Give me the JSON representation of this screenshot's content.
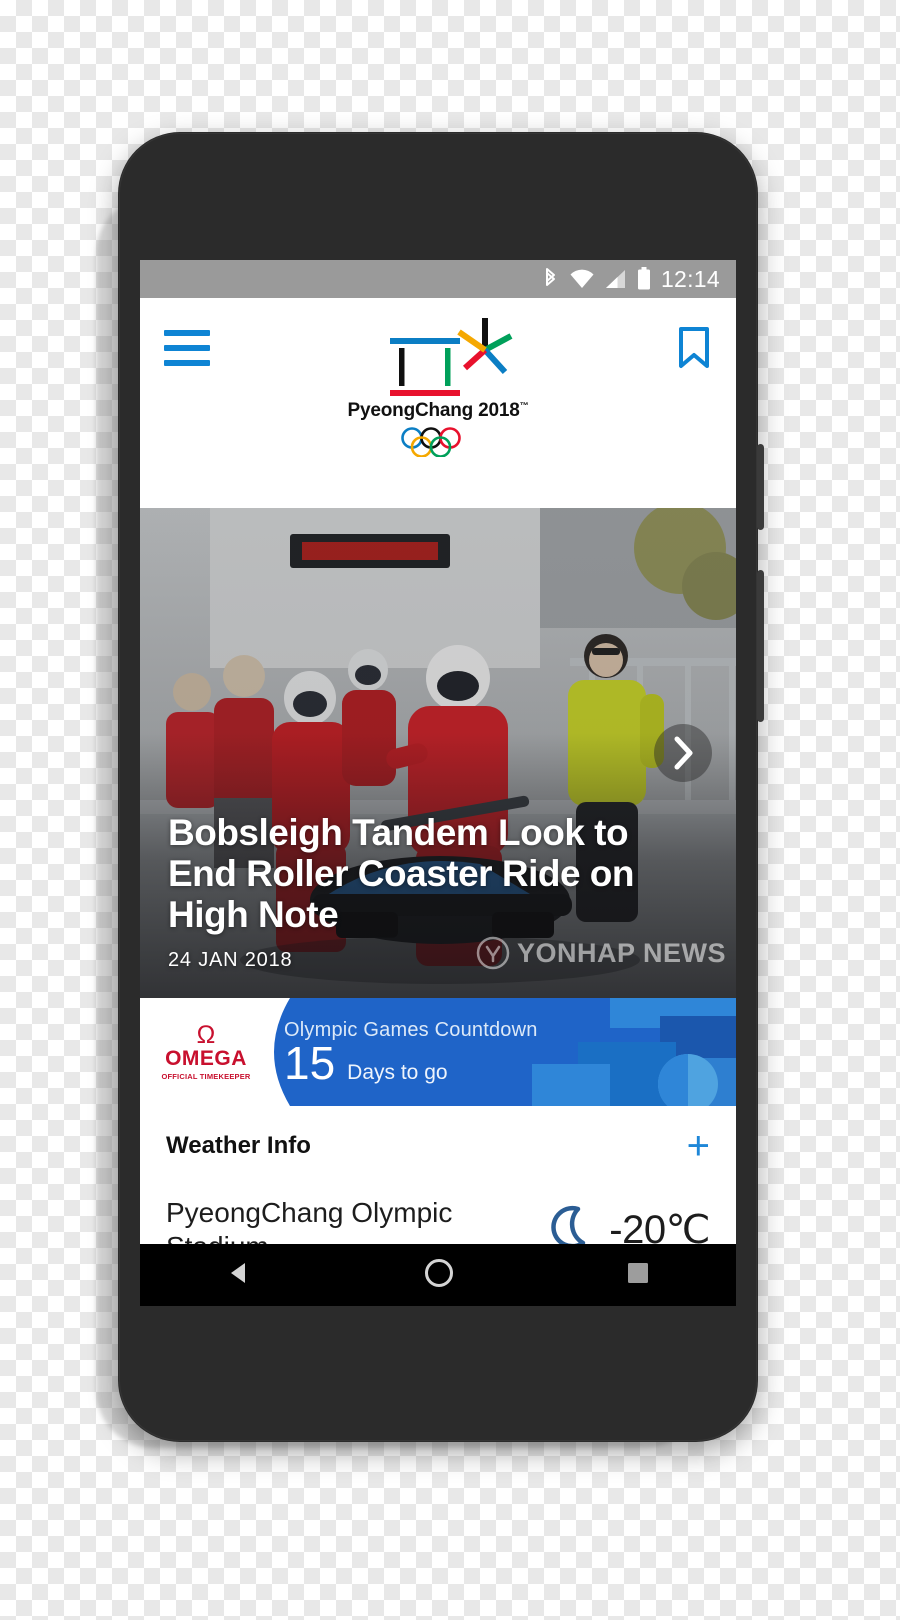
{
  "device": {
    "frame_color": "#2b2b2b",
    "camera_icon": "front-camera",
    "speaker_icon": "earpiece-speaker"
  },
  "statusbar": {
    "time": "12:14",
    "icons": [
      "bluetooth-icon",
      "wifi-icon",
      "cellular-signal-icon",
      "battery-icon"
    ],
    "background": "#9a9a9a"
  },
  "appbar": {
    "menu_icon": "hamburger-menu-icon",
    "bookmark_icon": "bookmark-icon",
    "accent_color": "#0e84d4",
    "logo": {
      "wordmark": "PyeongChang 2018",
      "trademark": "™",
      "rings_icon": "olympic-rings"
    }
  },
  "hero": {
    "title": "Bobsleigh Tandem Look to End Roller Coaster Ride on High Note",
    "date": "24 JAN 2018",
    "watermark": "YONHAP NEWS",
    "next_icon": "chevron-right-icon"
  },
  "countdown": {
    "sponsor_symbol": "Ω",
    "sponsor_name": "OMEGA",
    "sponsor_role": "OFFICIAL TIMEKEEPER",
    "sponsor_color": "#c8102e",
    "label": "Olympic Games Countdown",
    "days": "15",
    "unit": "Days to go",
    "background": "#1f64c8"
  },
  "weather": {
    "title": "Weather Info",
    "expand_icon": "plus-icon",
    "expand_label": "+",
    "accent_color": "#1e87d8",
    "location": "PyeongChang Olympic Stadium",
    "condition_icon": "crescent-moon-icon",
    "temperature": "-20℃"
  },
  "navbar": {
    "back_icon": "triangle-back-icon",
    "home_icon": "circle-home-icon",
    "recents_icon": "square-recents-icon"
  }
}
